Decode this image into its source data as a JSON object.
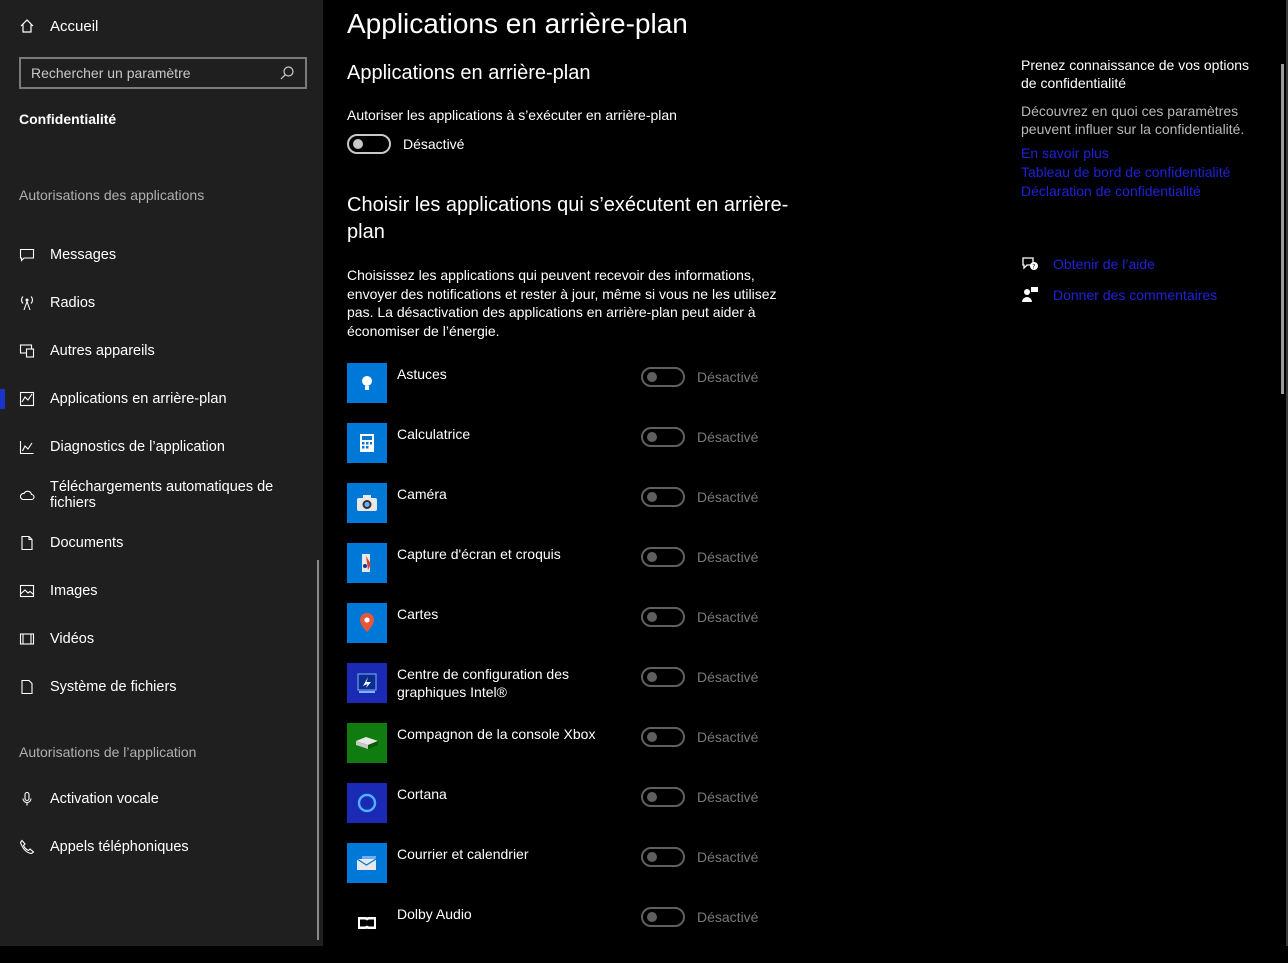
{
  "sidebar": {
    "home_label": "Accueil",
    "search_placeholder": "Rechercher un paramètre",
    "section_title": "Confidentialité",
    "group1_label": "Autorisations des applications",
    "group1_items": [
      {
        "label": "Messages",
        "icon": "message-icon"
      },
      {
        "label": "Radios",
        "icon": "radio-antenna-icon"
      },
      {
        "label": "Autres appareils",
        "icon": "devices-icon"
      },
      {
        "label": "Applications en arrière-plan",
        "icon": "background-apps-icon"
      },
      {
        "label": "Diagnostics de l’application",
        "icon": "diagnostics-icon"
      },
      {
        "label": "Téléchargements automatiques de fichiers",
        "icon": "cloud-icon"
      },
      {
        "label": "Documents",
        "icon": "document-icon"
      },
      {
        "label": "Images",
        "icon": "image-icon"
      },
      {
        "label": "Vidéos",
        "icon": "video-icon"
      },
      {
        "label": "Système de fichiers",
        "icon": "file-system-icon"
      }
    ],
    "group2_label": "Autorisations de l’application",
    "group2_items": [
      {
        "label": "Activation vocale",
        "icon": "microphone-icon"
      },
      {
        "label": "Appels téléphoniques",
        "icon": "phone-icon"
      }
    ]
  },
  "main": {
    "page_title": "Applications en arrière-plan",
    "section1_title": "Applications en arrière-plan",
    "allow_label": "Autoriser les applications à s’exécuter en arrière-plan",
    "allow_state": "Désactivé",
    "section2_title_line1": "Choisir les applications qui s’exécutent en arrière-",
    "section2_title_line2": "plan",
    "description": "Choisissez les applications qui peuvent recevoir des informations, envoyer des notifications et rester à jour, même si vous ne les utilisez pas. La désactivation des applications en arrière-plan peut aider à économiser de l’énergie.",
    "apps": [
      {
        "name": "Astuces",
        "state": "Désactivé",
        "icon": "lightbulb-icon",
        "color": "#0078d7"
      },
      {
        "name": "Calculatrice",
        "state": "Désactivé",
        "icon": "calculator-icon",
        "color": "#0078d7"
      },
      {
        "name": "Caméra",
        "state": "Désactivé",
        "icon": "camera-icon",
        "color": "#0078d7"
      },
      {
        "name": "Capture d'écran et croquis",
        "state": "Désactivé",
        "icon": "snip-sketch-icon",
        "color": "#0078d7"
      },
      {
        "name": "Cartes",
        "state": "Désactivé",
        "icon": "map-pin-icon",
        "color": "#0078d7"
      },
      {
        "name": "Centre de configuration des graphiques Intel®",
        "state": "Désactivé",
        "icon": "intel-graphics-icon",
        "color": "#1a2ab5"
      },
      {
        "name": "Compagnon de la console Xbox",
        "state": "Désactivé",
        "icon": "xbox-console-icon",
        "color": "#107c10"
      },
      {
        "name": "Cortana",
        "state": "Désactivé",
        "icon": "cortana-icon",
        "color": "#1a2ab5"
      },
      {
        "name": "Courrier et calendrier",
        "state": "Désactivé",
        "icon": "mail-icon",
        "color": "#0078d7"
      },
      {
        "name": "Dolby Audio",
        "state": "Désactivé",
        "icon": "dolby-icon",
        "color": "#000000"
      }
    ]
  },
  "right_panel": {
    "title": "Prenez connaissance de vos options de confidentialité",
    "description": "Découvrez en quoi ces paramètres peuvent influer sur la confidentialité.",
    "links": [
      "En savoir plus",
      "Tableau de bord de confidentialité",
      "Déclaration de confidentialité"
    ],
    "help_label": "Obtenir de l’aide",
    "feedback_label": "Donner des commentaires"
  },
  "colors": {
    "accent": "#1a33c8",
    "link": "#1e22d8",
    "sidebar_bg": "#1f1f1f",
    "main_bg": "#000000"
  }
}
